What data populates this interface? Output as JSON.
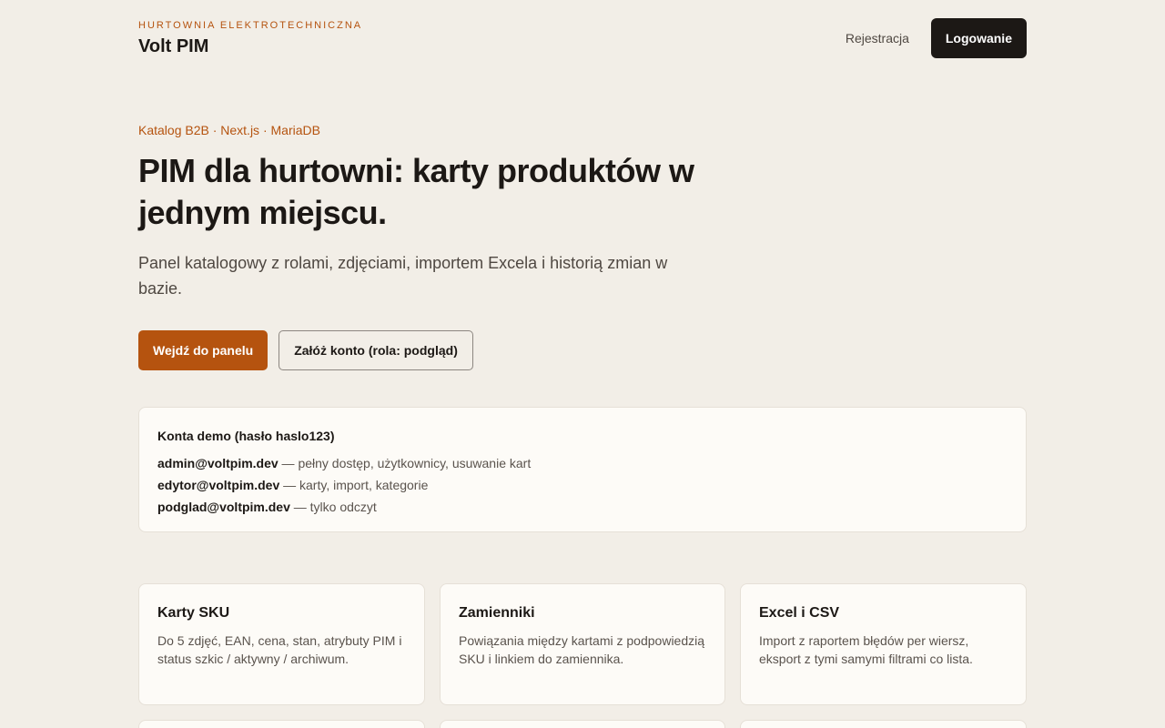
{
  "header": {
    "eyebrow": "HURTOWNIA ELEKTROTECHNICZNA",
    "brand": "Volt PIM",
    "register_label": "Rejestracja",
    "login_label": "Logowanie"
  },
  "hero": {
    "eyebrow": "Katalog B2B · Next.js · MariaDB",
    "title": "PIM dla hurtowni: karty produktów w jednym miejscu.",
    "subtitle": "Panel katalogowy z rolami, zdjęciami, importem Excela i historią zmian w bazie.",
    "primary_button": "Wejdź do panelu",
    "secondary_button": "Załóż konto (rola: podgląd)"
  },
  "demo": {
    "title": "Konta demo (hasło haslo123)",
    "accounts": [
      {
        "email": "admin@voltpim.dev",
        "desc": " — pełny dostęp, użytkownicy, usuwanie kart"
      },
      {
        "email": "edytor@voltpim.dev",
        "desc": " — karty, import, kategorie"
      },
      {
        "email": "podglad@voltpim.dev",
        "desc": " — tylko odczyt"
      }
    ]
  },
  "features": [
    {
      "title": "Karty SKU",
      "desc": "Do 5 zdjęć, EAN, cena, stan, atrybuty PIM i status szkic / aktywny / archiwum."
    },
    {
      "title": "Zamienniki",
      "desc": "Powiązania między kartami z podpowiedzią SKU i linkiem do zamiennika."
    },
    {
      "title": "Excel i CSV",
      "desc": "Import z raportem błędów per wiersz, eksport z tymi samymi filtrami co lista."
    }
  ],
  "colors": {
    "background": "#f2eee7",
    "accent": "#b5530f",
    "dark": "#1c1815",
    "card": "#fdfbf7"
  }
}
